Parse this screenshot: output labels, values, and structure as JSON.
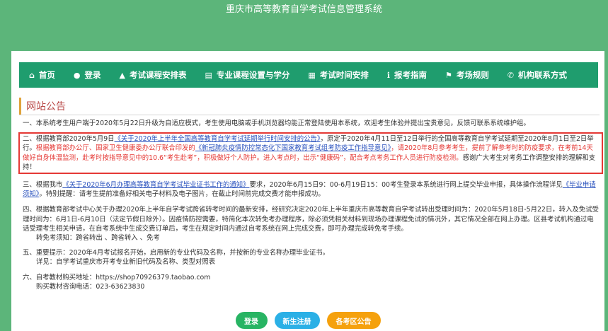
{
  "app_title": "重庆市高等教育自学考试信息管理系统",
  "nav": [
    {
      "icon": "home-icon",
      "glyph": "⌂",
      "label": "首页"
    },
    {
      "icon": "user-icon",
      "glyph": "●",
      "label": "登录"
    },
    {
      "icon": "graduation-cap-icon",
      "glyph": "▲",
      "label": "考试课程安排表"
    },
    {
      "icon": "list-icon",
      "glyph": "▤",
      "label": "专业课程设置与学分"
    },
    {
      "icon": "calendar-icon",
      "glyph": "▦",
      "label": "考试时间安排"
    },
    {
      "icon": "info-icon",
      "glyph": "ℹ",
      "label": "报考指南"
    },
    {
      "icon": "flag-icon",
      "glyph": "⚑",
      "label": "考场规则"
    },
    {
      "icon": "phone-icon",
      "glyph": "✆",
      "label": "机构联系方式"
    }
  ],
  "section_title": "网站公告",
  "p1": "一、本系统考生用户端于2020年5月22日升级为自适应模式，考生使用电脑或手机浏览器均能正常登陆使用本系统，欢迎考生体验并提出宝贵意见，反馈可联系系统维护组。",
  "p2": {
    "a": "二、根据教育部2020年5月9日",
    "link1": "《关于2020年上半年全国高等教育自学考试延期举行时间安排的公告》",
    "b": "，原定于2020年4月11日至12日举行的全国高等教育自学考试延期至2020年8月1日至2日举行。",
    "red": "根据教育部办公厅、国家卫生健康委办公厅联合印发的",
    "link2": "《新冠肺炎疫情防控常态化下国家教育考试组考防疫工作指导意见》",
    "red2": "，请2020年8月参考考生，提前了解参考时的防疫要求，在考前14天做好自身体温监测，赴考时按指导意见中的10.6“考生赴考”，积极做好个人防护。进入考点时，出示“健康码”，配合考点考务工作人员进行防疫检测。",
    "c": "感谢广大考生对考务工作调整安排的理解和支持！"
  },
  "p3": {
    "a": "三、根据我市",
    "link": "《关于2020年6月办理高等教育自学考试毕业证书工作的通知》",
    "b": "要求，2020年6月15日9：00-6月19日15：00考生登录本系统进行网上提交毕业申报，具体操作流程详见",
    "link2": "《毕业申请须知》",
    "c": "。特别提醒：请考生提前准备好相关电子材料及电子图片，在截止时间前完成交费才能申报成功。"
  },
  "p4": {
    "a": "四、根据教育部考试中心关于办理2020年上半年自学考试跨省转考时间的最新安排，经研究决定2020年上半年重庆市高等教育自学考试转出受理时间为：2020年5月18日-5月22日，转入及免试受理时间为：6月1日-6月10日（法定节假日除外）。因疫情防控需要，特简化本次转免考办理程序，除必须凭相关材料到现场办理课程免试的情况外，其它情况全部在网上办理。区县考试机构通过电话受理考生相关申请，在自考系统中生成交费订单后，考生在规定时间内通过自考系统在网上完成交费，即可办理完成转免考手续。",
    "sub": "转免考须知：跨省转出 、跨省转入 、免考"
  },
  "p5": {
    "a": "五、重要提示：2020年4月考试报名开始，启用新的专业代码及名称，并按新的专业名称办理毕业证书。",
    "sub": "详见：自学考试重庆市开考专业新旧代码及名称、类型对照表"
  },
  "p6": {
    "a": "六、自考教材购买地址：https://shop70926379.taobao.com",
    "sub": "购买教材咨询电话：023-63623830"
  },
  "buttons": {
    "login": "登录",
    "register": "新生注册",
    "notice": "各考区公告"
  }
}
